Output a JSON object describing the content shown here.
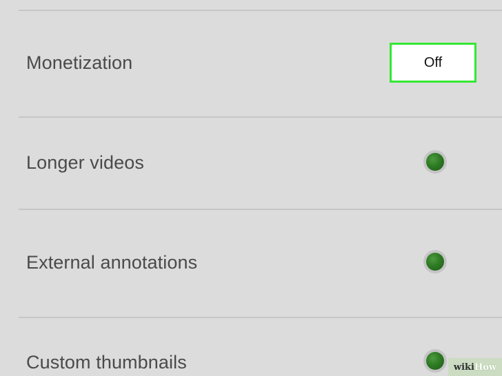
{
  "settings": {
    "rows": [
      {
        "label": "Monetization",
        "control": "button",
        "value": "Off"
      },
      {
        "label": "Longer videos",
        "control": "indicator",
        "status_color": "#2e7a24"
      },
      {
        "label": "External annotations",
        "control": "indicator",
        "status_color": "#2e7a24"
      },
      {
        "label": "Custom thumbnails",
        "control": "indicator",
        "status_color": "#2e7a24"
      }
    ]
  },
  "colors": {
    "background": "#dcdcdc",
    "highlight_border": "#33e833",
    "status_green": "#2e7a24"
  },
  "watermark": {
    "wiki": "wiki",
    "how": "How"
  }
}
